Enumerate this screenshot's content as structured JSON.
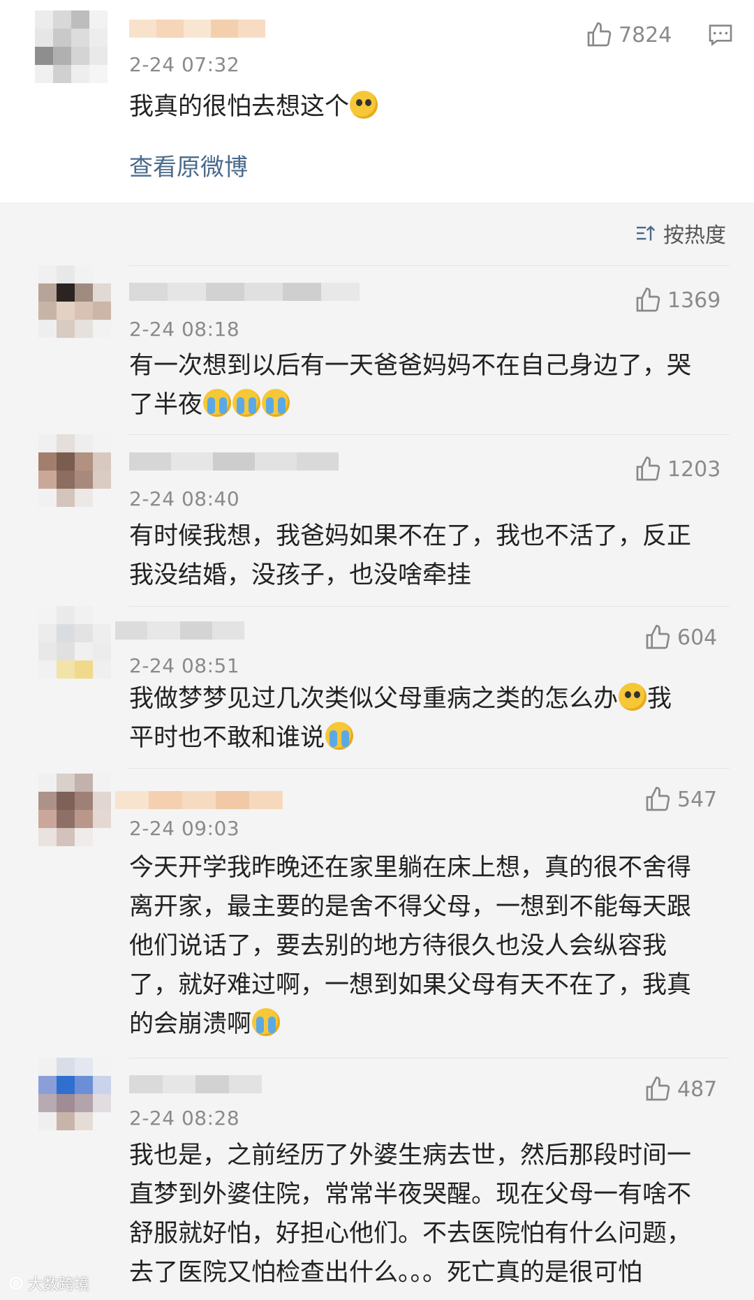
{
  "top_post": {
    "time": "2-24 07:32",
    "likes": "7824",
    "text": "我真的很怕去想这个",
    "view_original": "查看原微博"
  },
  "sort_label": "按热度",
  "comments": [
    {
      "time": "2-24 08:18",
      "likes": "1369",
      "lines": [
        "有一次想到以后有一天爸爸妈妈不在自己身边了，哭",
        "了半夜"
      ]
    },
    {
      "time": "2-24 08:40",
      "likes": "1203",
      "lines": [
        "有时候我想，我爸妈如果不在了，我也不活了，反正",
        "我没结婚，没孩子，也没啥牵挂"
      ]
    },
    {
      "time": "2-24 08:51",
      "likes": "604",
      "lines": [
        "我做梦梦见过几次类似父母重病之类的怎么办",
        "我",
        "平时也不敢和谁说"
      ]
    },
    {
      "time": "2-24 09:03",
      "likes": "547",
      "lines": [
        "今天开学我昨晚还在家里躺在床上想，真的很不舍得",
        "离开家，最主要的是舍不得父母，一想到不能每天跟",
        "他们说话了，要去别的地方待很久也没人会纵容我",
        "了，就好难过啊，一想到如果父母有天不在了，我真",
        "的会崩溃啊"
      ]
    },
    {
      "time": "2-24 08:28",
      "likes": "487",
      "lines": [
        "我也是，之前经历了外婆生病去世，然后那段时间一",
        "直梦到外婆住院，常常半夜哭醒。现在父母一有啥不",
        "舒服就好怕，好担心他们。不去医院怕有什么问题，",
        "去了医院又怕检查出什么。。。死亡真的是很可怕"
      ]
    }
  ],
  "watermark": "大数跨境",
  "colors": {
    "link": "#4a6b8c",
    "meta": "#8a8a8a",
    "emoji": "#f6c736"
  }
}
